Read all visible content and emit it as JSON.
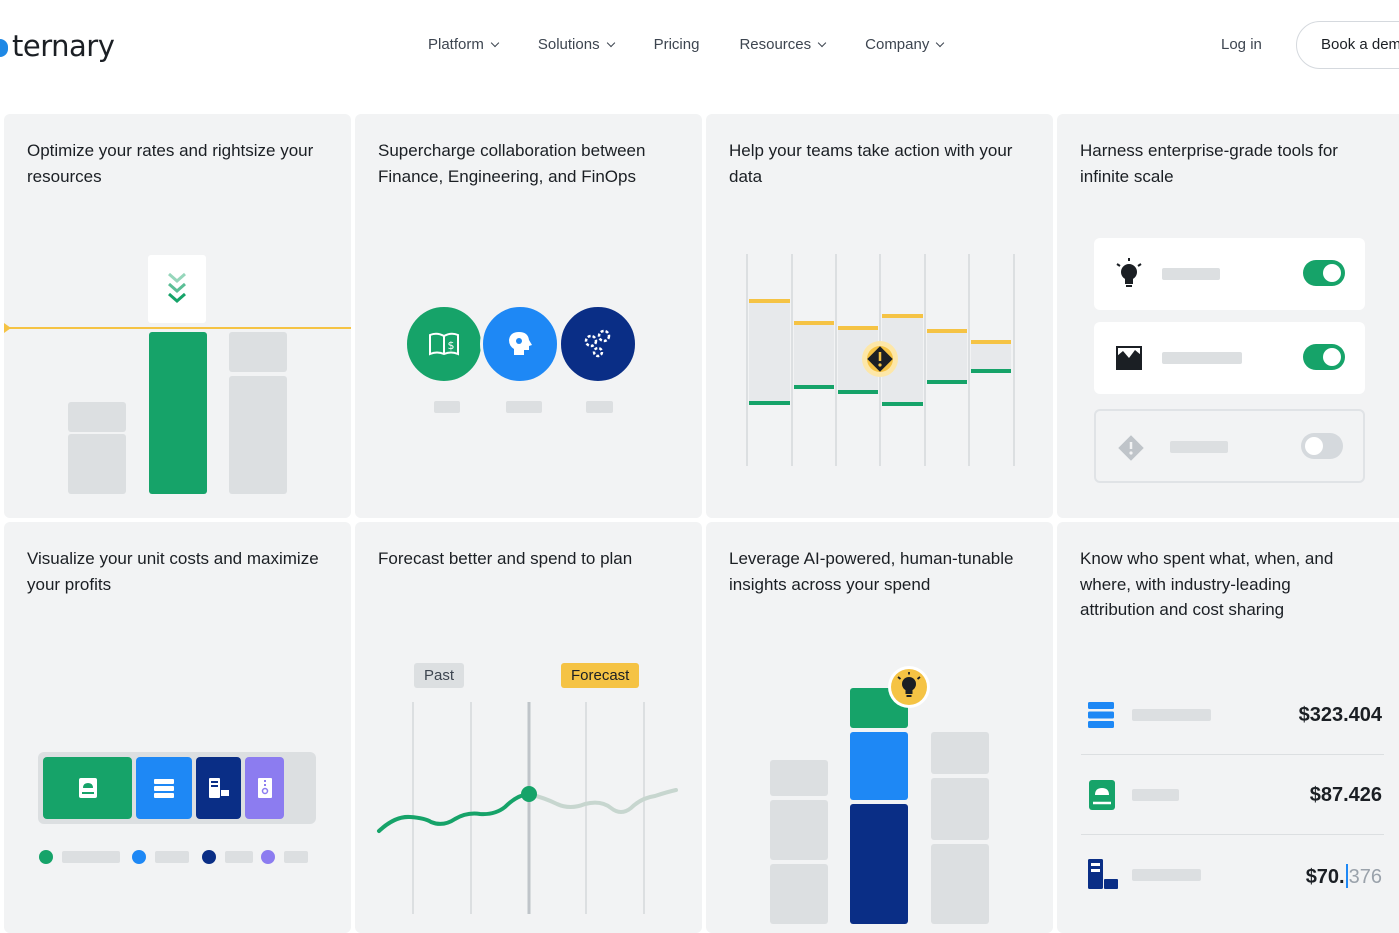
{
  "header": {
    "logo": "ternary",
    "nav": [
      {
        "label": "Platform",
        "has_menu": true
      },
      {
        "label": "Solutions",
        "has_menu": true
      },
      {
        "label": "Pricing",
        "has_menu": false
      },
      {
        "label": "Resources",
        "has_menu": true
      },
      {
        "label": "Company",
        "has_menu": true
      }
    ],
    "login": "Log in",
    "book_demo": "Book a demo"
  },
  "cards": [
    {
      "title": "Optimize your rates and rightsize your resources"
    },
    {
      "title": "Supercharge collaboration between Finance, Engineering, and FinOps"
    },
    {
      "title": "Help your teams take action with your data"
    },
    {
      "title": "Harness enterprise-grade tools for infinite scale"
    },
    {
      "title": "Visualize your unit costs and maximize your profits"
    },
    {
      "title": "Forecast better and spend to plan"
    },
    {
      "title": "Leverage AI-powered, human-tunable insights across your spend"
    },
    {
      "title": "Know who spent what, when, and where, with industry-leading attribution and cost sharing"
    }
  ],
  "forecast": {
    "past_label": "Past",
    "forecast_label": "Forecast"
  },
  "attribution": {
    "rows": [
      {
        "icon": "database-icon",
        "amount": "$323.404"
      },
      {
        "icon": "cloud-server-icon",
        "amount": "$87.426"
      },
      {
        "icon": "network-icon",
        "amount_main": "$70.",
        "amount_faded": "376"
      }
    ]
  },
  "colors": {
    "green": "#16a369",
    "blue": "#1e88f5",
    "navy": "#0a2e86",
    "purple": "#8c7cf0",
    "yellow": "#f5c344",
    "gray": "#dcdfe1"
  }
}
